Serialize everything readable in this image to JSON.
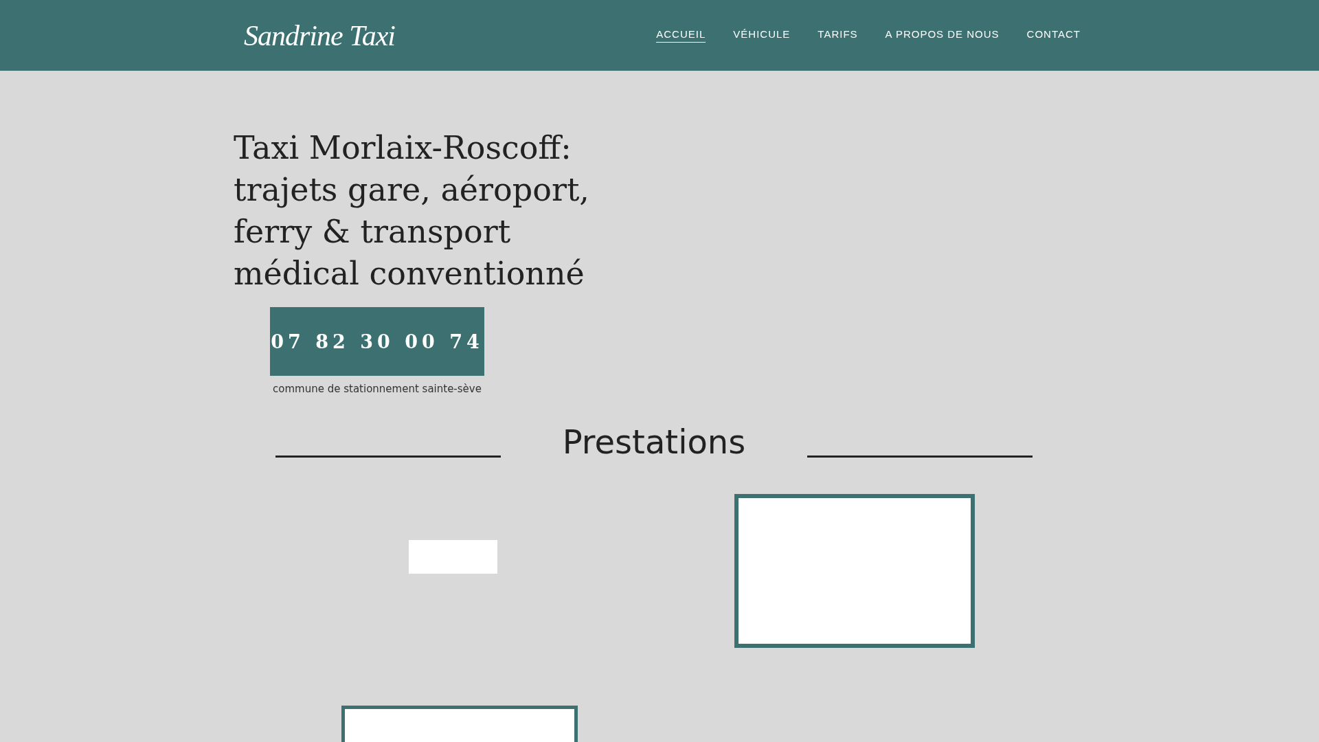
{
  "header": {
    "logo": "Sandrine Taxi",
    "nav": [
      {
        "label": "ACCUEIL",
        "selected": true
      },
      {
        "label": "VÉHICULE",
        "selected": false
      },
      {
        "label": "TARIFS",
        "selected": false
      },
      {
        "label": "A PROPOS DE NOUS",
        "selected": false
      },
      {
        "label": "CONTACT",
        "selected": false
      }
    ]
  },
  "hero": {
    "title": "Taxi Morlaix-Roscoff: trajets gare, aéroport, ferry & transport médical conventionné",
    "phone": "07 82 30 00 74",
    "caption": "commune de stationnement sainte-sève"
  },
  "section": {
    "title": "Prestations"
  }
}
